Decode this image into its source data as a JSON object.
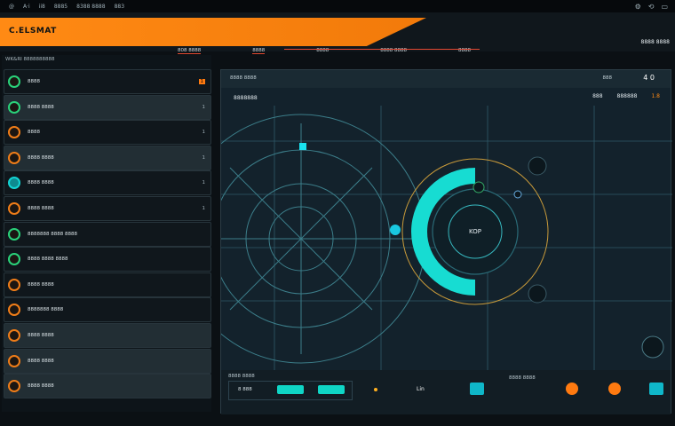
{
  "menubar": {
    "items": [
      "@",
      "A·i",
      "ii8",
      "8885",
      "8388 8888",
      "883"
    ],
    "right_icons": [
      "gear-icon",
      "refresh-icon",
      "window-icon"
    ]
  },
  "header": {
    "title": "C.ELSMAT",
    "tabs": [
      "808 8888",
      "8888",
      "8888",
      "8888 8888",
      "8888"
    ],
    "right": "8888 8888"
  },
  "leftpanel": {
    "heading": "WK&RI 8888888888",
    "rows": [
      {
        "label": "8888",
        "tag": "1"
      },
      {
        "label": "8888 8888",
        "tag": "1"
      },
      {
        "label": "8888",
        "tag": "1"
      },
      {
        "label": "8888 8888",
        "tag": "1"
      },
      {
        "label": "8888 8888",
        "tag": "1"
      },
      {
        "label": "8888 8888",
        "tag": "1"
      },
      {
        "label": "8888888 8888 8888",
        "tag": ""
      },
      {
        "label": "8888 8888 8888",
        "tag": ""
      },
      {
        "label": "8888 8888",
        "tag": ""
      },
      {
        "label": "8888888 8888",
        "tag": ""
      },
      {
        "label": "8888 8888",
        "tag": ""
      },
      {
        "label": "8888 8888",
        "tag": ""
      },
      {
        "label": "8888 8888",
        "tag": ""
      }
    ]
  },
  "main": {
    "topbar_title": "8888 8888",
    "topbar_r1": "888",
    "topbar_r2": "4 0",
    "subtitle": "8888888",
    "sub_right": [
      "888",
      "888888",
      "1.8"
    ],
    "center_label": "KOP"
  },
  "bottombar": {
    "label": "8888 8888",
    "small": "8 888",
    "mid": "Lin",
    "label2": "8888 8888"
  }
}
